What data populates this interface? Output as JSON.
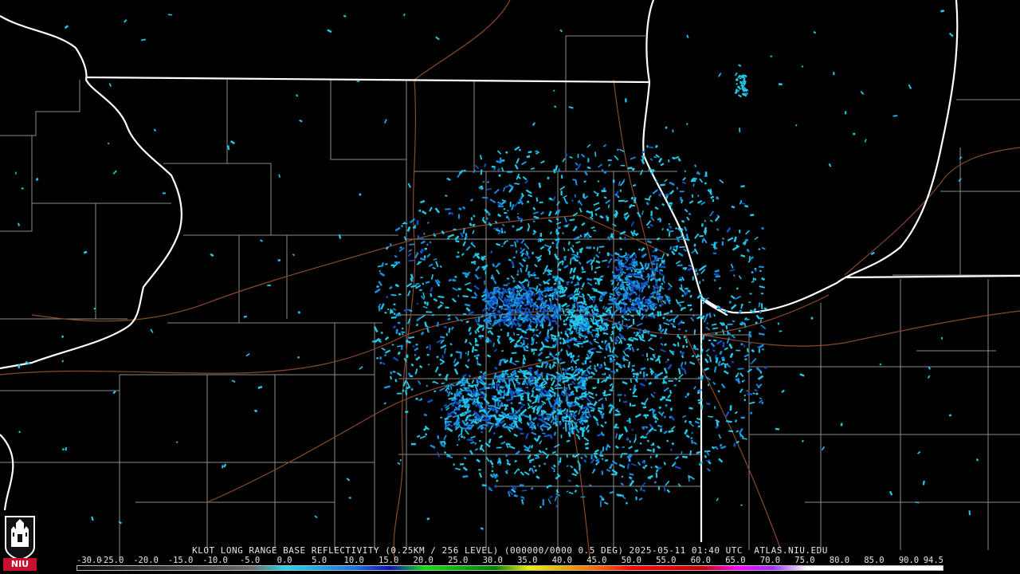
{
  "product": {
    "caption": "KLOT LONG RANGE BASE REFLECTIVITY (0.25KM / 256 LEVEL) (000000/0000 0.5 DEG) 2025-05-11 01:40 UTC  ATLAS.NIU.EDU"
  },
  "logo": {
    "name": "NIU",
    "colors": {
      "shield": "#ffffff",
      "band": "#c8102e",
      "background": "#111111"
    }
  },
  "legend": {
    "labels": [
      "-30.0",
      "-25.0",
      "-20.0",
      "-15.0",
      "-10.0",
      "-5.0",
      "0.0",
      "5.0",
      "10.0",
      "15.0",
      "20.0",
      "25.0",
      "30.0",
      "35.0",
      "40.0",
      "45.0",
      "50.0",
      "55.0",
      "60.0",
      "65.0",
      "70.0",
      "75.0",
      "80.0",
      "85.0",
      "90.0",
      "94.5"
    ],
    "color_stops": [
      {
        "dbz": -30,
        "color": "#0a0a0a"
      },
      {
        "dbz": -5,
        "color": "#6a6a6a"
      },
      {
        "dbz": 0,
        "color": "#20d8e8"
      },
      {
        "dbz": 10,
        "color": "#1a70e0"
      },
      {
        "dbz": 15,
        "color": "#1010c0"
      },
      {
        "dbz": 20,
        "color": "#10e010"
      },
      {
        "dbz": 30,
        "color": "#008000"
      },
      {
        "dbz": 35,
        "color": "#f0f000"
      },
      {
        "dbz": 40,
        "color": "#e8a800"
      },
      {
        "dbz": 45,
        "color": "#ff6000"
      },
      {
        "dbz": 50,
        "color": "#ff0000"
      },
      {
        "dbz": 60,
        "color": "#c80000"
      },
      {
        "dbz": 65,
        "color": "#ff00ff"
      },
      {
        "dbz": 70,
        "color": "#9b30ff"
      },
      {
        "dbz": 75,
        "color": "#ffffff"
      },
      {
        "dbz": 94.5,
        "color": "#ffffff"
      }
    ]
  },
  "map_colors": {
    "state_border": "#ffffff",
    "county_border": "#8c8c8c",
    "highway": "#8a4a2a",
    "echo_light": "#22c8e8",
    "echo_mid": "#1890e0",
    "echo_dark": "#1050c8"
  }
}
